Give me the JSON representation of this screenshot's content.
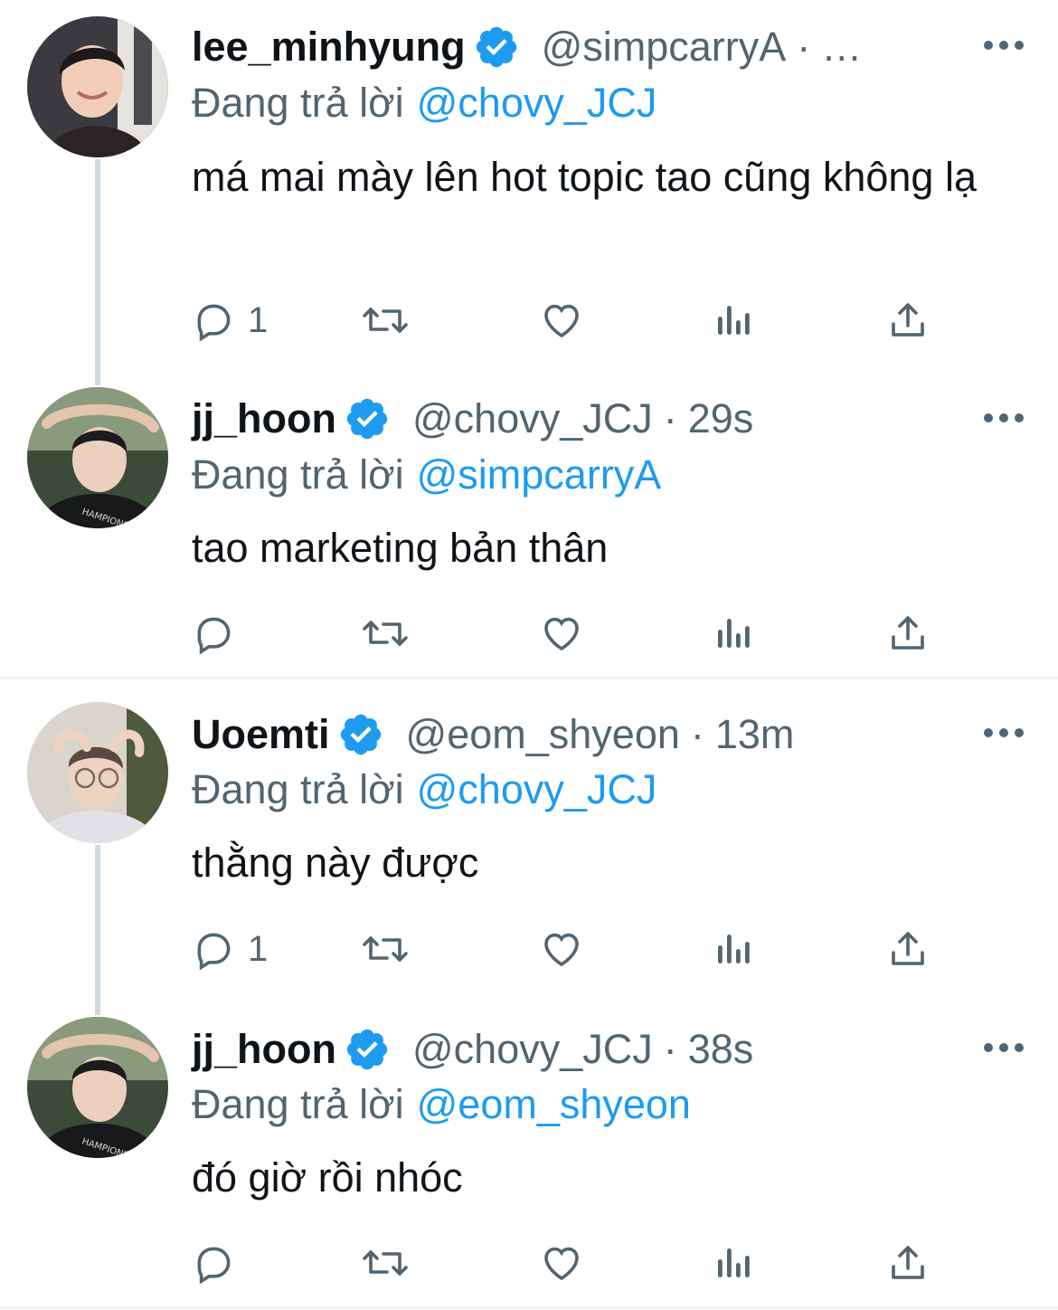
{
  "colors": {
    "accent": "#1d9bf0",
    "secondary_text": "#536471",
    "primary_text": "#0f1419",
    "thread_line": "#cfd9de"
  },
  "reply_prefix": "Đang trả lời",
  "tweets": [
    {
      "display_name": "lee_minhyung",
      "handle": "@simpcarryA",
      "separator": "·",
      "time": "…",
      "replying_to": "@chovy_JCJ",
      "text": "má mai mày lên hot topic tao cũng không lạ",
      "reply_count": "1",
      "avatar_icon": "avatar-photo",
      "verified_icon": "verified-badge-icon"
    },
    {
      "display_name": "jj_hoon",
      "handle": "@chovy_JCJ",
      "separator": "·",
      "time": "29s",
      "replying_to": "@simpcarryA",
      "text": "tao marketing bản thân",
      "reply_count": "",
      "avatar_icon": "avatar-photo",
      "verified_icon": "verified-badge-icon"
    },
    {
      "display_name": "Uoemti",
      "handle": "@eom_shyeon",
      "separator": "·",
      "time": "13m",
      "replying_to": "@chovy_JCJ",
      "text": "thằng này được",
      "reply_count": "1",
      "avatar_icon": "avatar-photo",
      "verified_icon": "verified-badge-icon"
    },
    {
      "display_name": "jj_hoon",
      "handle": "@chovy_JCJ",
      "separator": "·",
      "time": "38s",
      "replying_to": "@eom_shyeon",
      "text": "đó giờ rồi nhóc",
      "reply_count": "",
      "avatar_icon": "avatar-photo",
      "verified_icon": "verified-badge-icon"
    }
  ],
  "action_icons": [
    "reply-icon",
    "retweet-icon",
    "like-icon",
    "analytics-icon",
    "share-icon"
  ]
}
